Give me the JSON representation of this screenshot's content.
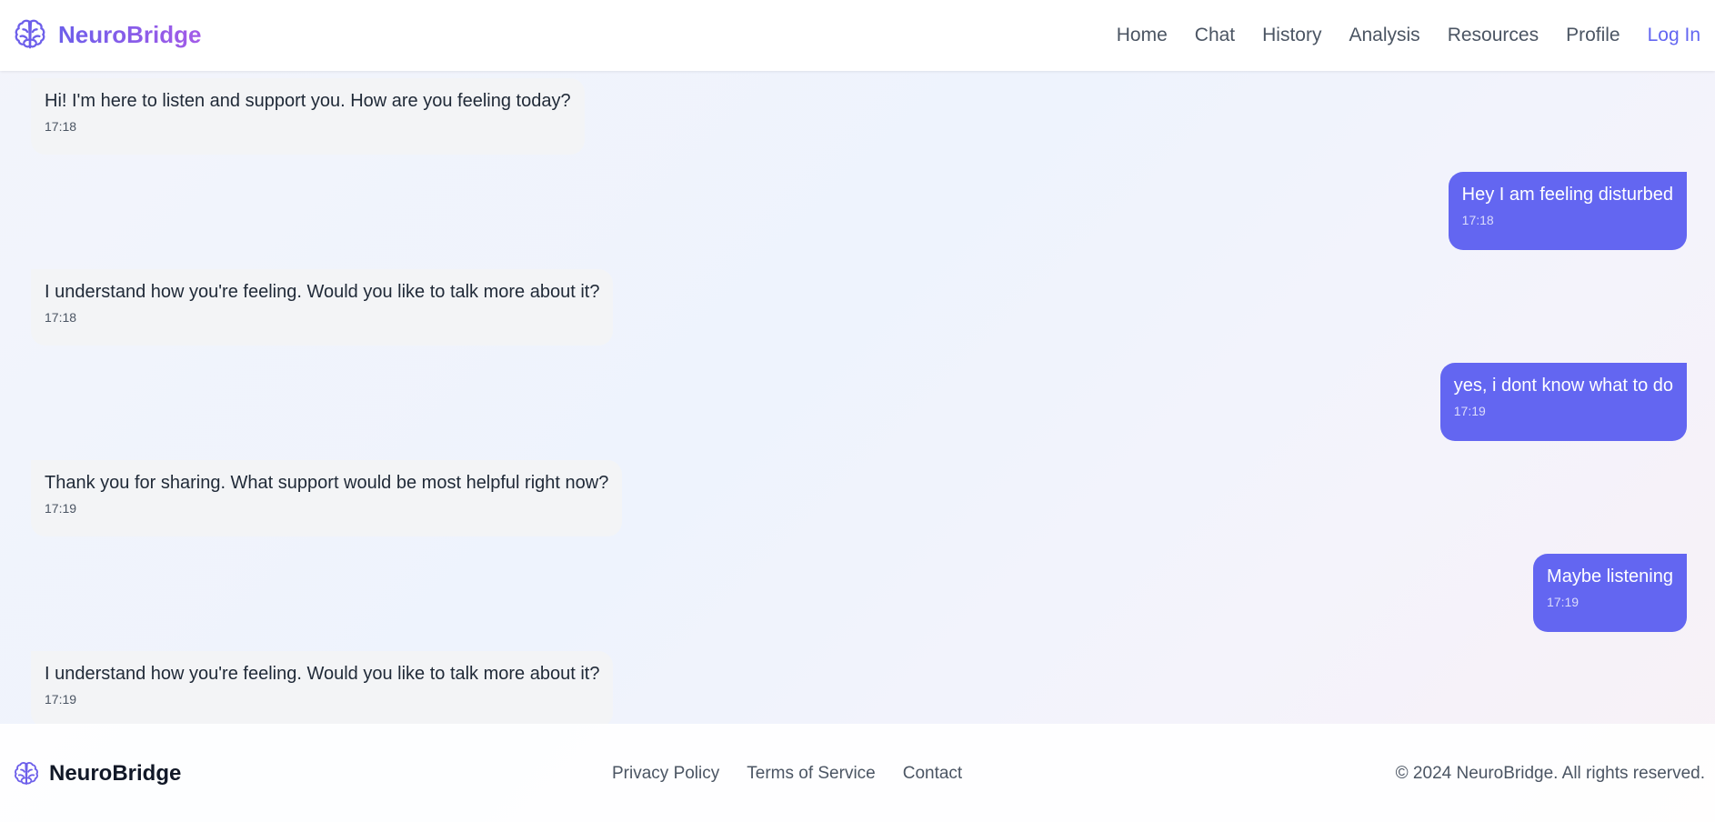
{
  "app": {
    "brand": "NeuroBridge",
    "accent_color": "#6366f1",
    "brand_gradient": [
      "#6d5fea",
      "#a35be8"
    ]
  },
  "nav": {
    "items": [
      {
        "label": "Home"
      },
      {
        "label": "Chat"
      },
      {
        "label": "History"
      },
      {
        "label": "Analysis"
      },
      {
        "label": "Resources"
      },
      {
        "label": "Profile"
      }
    ],
    "login_label": "Log In"
  },
  "chat": {
    "messages": [
      {
        "sender": "bot",
        "text": "Hi! I'm here to listen and support you. How are you feeling today?",
        "time": "17:18"
      },
      {
        "sender": "user",
        "text": "Hey I am feeling disturbed",
        "time": "17:18"
      },
      {
        "sender": "bot",
        "text": "I understand how you're feeling. Would you like to talk more about it?",
        "time": "17:18"
      },
      {
        "sender": "user",
        "text": "yes, i dont know what to do",
        "time": "17:19"
      },
      {
        "sender": "bot",
        "text": "Thank you for sharing. What support would be most helpful right now?",
        "time": "17:19"
      },
      {
        "sender": "user",
        "text": "Maybe listening",
        "time": "17:19"
      },
      {
        "sender": "bot",
        "text": "I understand how you're feeling. Would you like to talk more about it?",
        "time": "17:19"
      }
    ]
  },
  "footer": {
    "brand": "NeuroBridge",
    "links": [
      {
        "label": "Privacy Policy"
      },
      {
        "label": "Terms of Service"
      },
      {
        "label": "Contact"
      }
    ],
    "copyright": "© 2024 NeuroBridge. All rights reserved."
  }
}
